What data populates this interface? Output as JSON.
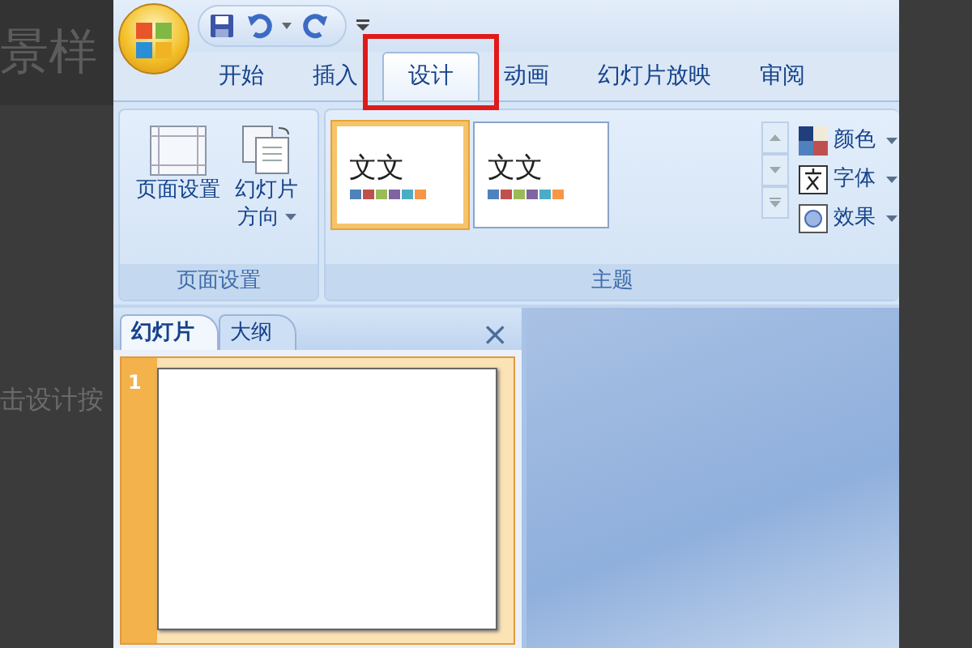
{
  "background_text": [
    {
      "text": "景样"
    },
    {
      "text": "击设计按"
    }
  ],
  "tabs": [
    {
      "label": "开始",
      "selected": false,
      "highlighted": false
    },
    {
      "label": "插入",
      "selected": false,
      "highlighted": false
    },
    {
      "label": "设计",
      "selected": true,
      "highlighted": true
    },
    {
      "label": "动画",
      "selected": false,
      "highlighted": false
    },
    {
      "label": "幻灯片放映",
      "selected": false,
      "highlighted": false
    },
    {
      "label": "审阅",
      "selected": false,
      "highlighted": false
    }
  ],
  "ribbon": {
    "page_setup": {
      "label": "页面设置",
      "buttons": [
        {
          "label": "页面设置",
          "dropdown": false
        },
        {
          "label": "幻灯片方向",
          "dropdown": true
        }
      ]
    },
    "themes": {
      "label": "主题",
      "gallery": [
        {
          "label": "文文",
          "selected": true
        },
        {
          "label": "文文",
          "selected": false
        }
      ],
      "menu": [
        {
          "kind": "colors",
          "label": "颜色"
        },
        {
          "kind": "fonts",
          "label": "字体"
        },
        {
          "kind": "effects",
          "label": "效果"
        }
      ]
    }
  },
  "slide_pane": {
    "tabs": [
      {
        "label": "幻灯片",
        "selected": true
      },
      {
        "label": "大纲",
        "selected": false
      }
    ],
    "close": "×",
    "slides": [
      {
        "number": "1",
        "selected": true
      }
    ]
  }
}
